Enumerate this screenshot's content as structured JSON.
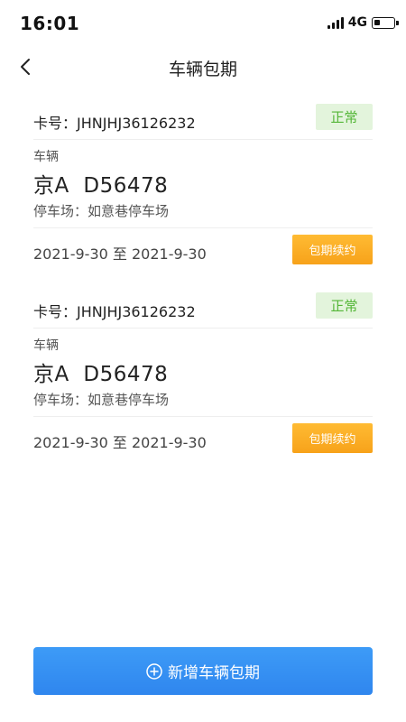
{
  "status_bar": {
    "time": "16:01",
    "network": "4G",
    "battery_level": 0.3
  },
  "nav": {
    "title": "车辆包期",
    "back_icon": "chevron-left-icon"
  },
  "cards": [
    {
      "card_no": "卡号：JHNJHJ36126232",
      "status": "正常",
      "vehicle_label": "车辆",
      "plate": "京A  D56478",
      "parking": "停车场：如意巷停车场",
      "dates": "2021-9-30 至 2021-9-30",
      "renew_label": "包期续约"
    },
    {
      "card_no": "卡号：JHNJHJ36126232",
      "status": "正常",
      "vehicle_label": "车辆",
      "plate": "京A  D56478",
      "parking": "停车场：如意巷停车场",
      "dates": "2021-9-30 至 2021-9-30",
      "renew_label": "包期续约"
    }
  ],
  "add_button": {
    "label": "新增车辆包期",
    "icon": "plus-circle-icon"
  },
  "colors": {
    "status_green": "#54b637",
    "status_bg": "#e3f4dc",
    "renew_orange": "#f7a21a",
    "primary_blue": "#3d9bf7"
  }
}
